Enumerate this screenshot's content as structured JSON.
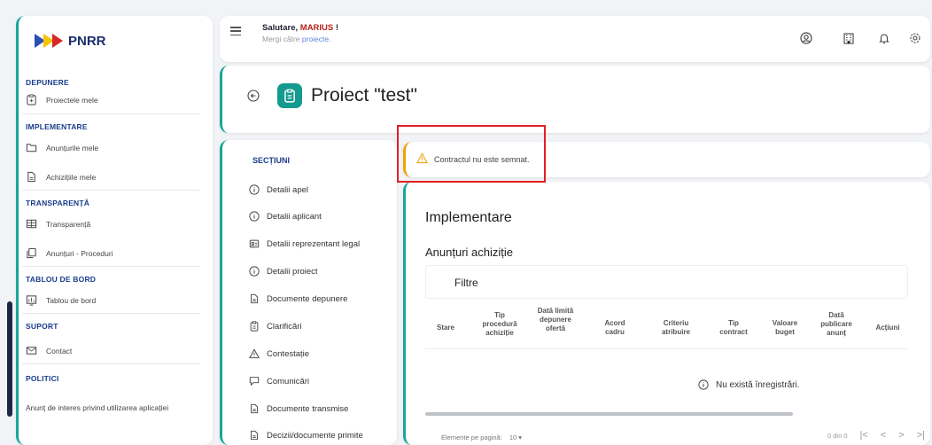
{
  "brand": {
    "logo_text": "PNRR"
  },
  "sidebar": {
    "sections": [
      {
        "title": "DEPUNERE",
        "items": [
          {
            "label": "Proiectele mele",
            "icon": "clipboard-arrow-icon"
          }
        ]
      },
      {
        "title": "IMPLEMENTARE",
        "items": [
          {
            "label": "Anunțurile mele",
            "icon": "folder-icon"
          },
          {
            "label": "Achizițiile mele",
            "icon": "document-icon"
          }
        ]
      },
      {
        "title": "TRANSPARENȚĂ",
        "items": [
          {
            "label": "Transparență",
            "icon": "table-icon"
          },
          {
            "label": "Anunțuri - Proceduri",
            "icon": "copy-icon"
          }
        ]
      },
      {
        "title": "TABLOU DE BORD",
        "items": [
          {
            "label": "Tablou de bord",
            "icon": "chart-icon"
          }
        ]
      },
      {
        "title": "SUPORT",
        "items": [
          {
            "label": "Contact",
            "icon": "mail-icon"
          }
        ]
      },
      {
        "title": "POLITICI",
        "items": [
          {
            "label": "Anunț de interes privind utilizarea aplicației",
            "icon": ""
          }
        ]
      }
    ]
  },
  "topbar": {
    "greeting_prefix": "Salutare, ",
    "user_name": "MARIUS",
    "greeting_suffix": " !",
    "subtitle_prefix": "Mergi către ",
    "subtitle_link": "proiecte."
  },
  "header": {
    "title": "Proiect \"test\""
  },
  "sections": {
    "heading": "SECȚIUNI",
    "items": [
      {
        "label": "Detalii apel",
        "icon": "info-icon"
      },
      {
        "label": "Detalii aplicant",
        "icon": "info-icon"
      },
      {
        "label": "Detalii reprezentant legal",
        "icon": "id-card-icon"
      },
      {
        "label": "Detalii proiect",
        "icon": "info-icon"
      },
      {
        "label": "Documente depunere",
        "icon": "document-icon"
      },
      {
        "label": "Clarificări",
        "icon": "clipboard-icon"
      },
      {
        "label": "Contestație",
        "icon": "warning-icon"
      },
      {
        "label": "Comunicări",
        "icon": "chat-icon"
      },
      {
        "label": "Documente transmise",
        "icon": "document-icon"
      },
      {
        "label": "Decizii/documente primite",
        "icon": "document-icon"
      }
    ]
  },
  "alert": {
    "text": "Contractul nu este semnat.",
    "color": "#f1a30b"
  },
  "main": {
    "title": "Implementare",
    "subtitle": "Anunțuri achiziție",
    "filters_label": "Filtre",
    "columns": [
      "Stare",
      "Tip procedură achiziție",
      "Dată limită depunere ofertă",
      "Acord cadru",
      "Criteriu atribuire",
      "Tip contract",
      "Valoare buget",
      "Dată publicare anunț",
      "Acțiuni"
    ],
    "empty_text": "Nu există înregistrări.",
    "per_page_label": "Elemente pe pagină:",
    "per_page_value": "10",
    "range_text": "0 din 0"
  },
  "colors": {
    "accent": "#149a8f",
    "brand_blue": "#1a3d8c",
    "highlight": "#e21f26"
  }
}
